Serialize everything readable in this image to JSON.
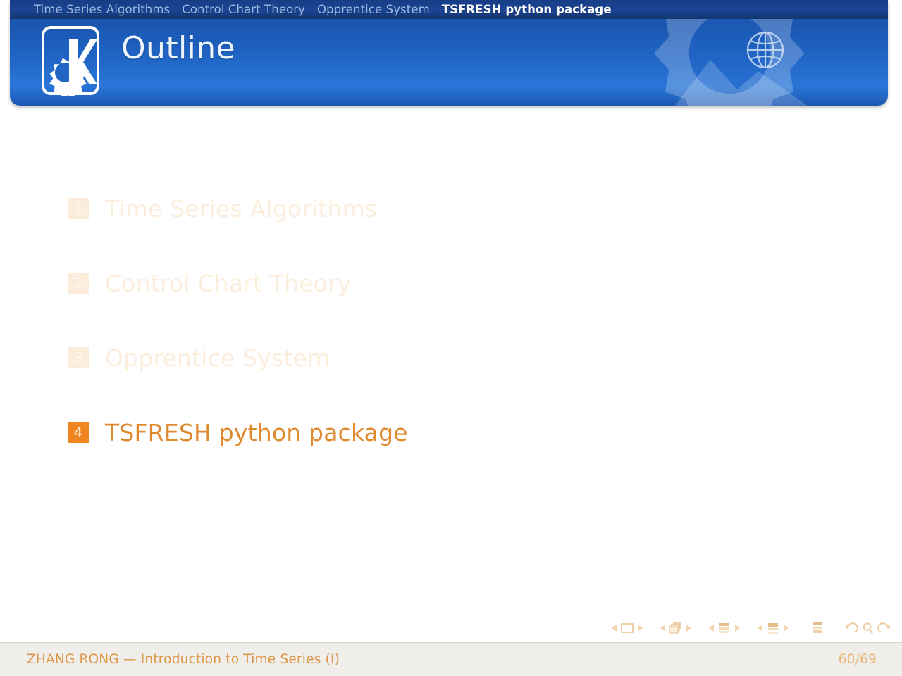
{
  "header": {
    "title": "Outline",
    "logo_icon": "kde-k-gear-logo",
    "globe_icon": "globe-icon",
    "gear_watermark_icon": "gear-watermark-icon",
    "mountain_watermark_icon": "mountain-watermark-icon",
    "navbar": [
      {
        "label": "Time Series Algorithms",
        "active": false
      },
      {
        "label": "Control Chart Theory",
        "active": false
      },
      {
        "label": "Opprentice System",
        "active": false
      },
      {
        "label": "TSFRESH python package",
        "active": true
      }
    ]
  },
  "outline": {
    "items": [
      {
        "number": "1",
        "label": "Time Series Algorithms",
        "state": "dim"
      },
      {
        "number": "2",
        "label": "Control Chart Theory",
        "state": "dim"
      },
      {
        "number": "3",
        "label": "Opprentice System",
        "state": "dim"
      },
      {
        "number": "4",
        "label": "TSFRESH python package",
        "state": "active"
      }
    ]
  },
  "nav_symbols": {
    "groups": [
      {
        "icon": "slide-navigation-icon",
        "prev": "◂",
        "next": "▸"
      },
      {
        "icon": "frame-navigation-icon",
        "prev": "◂",
        "next": "▸"
      },
      {
        "icon": "subsection-navigation-icon",
        "prev": "◂",
        "next": "▸"
      },
      {
        "icon": "section-navigation-icon",
        "prev": "◂",
        "next": "▸"
      }
    ],
    "presentation_icon": "presentation-document-icon",
    "back_icon": "back-arrow-icon",
    "search_icon": "search-magnifier-icon",
    "forward_icon": "forward-arrow-icon"
  },
  "footer": {
    "author_and_title": "ZHANG RONG — Introduction to Time Series (I)",
    "page": "60/69"
  },
  "colors": {
    "navbar_bg": "#1b4493",
    "title_band_bg": "#2064c4",
    "accent_orange": "#ef8521",
    "active_text": "#e08a30",
    "dim_text": "#fbeedd",
    "footer_bg": "#f0eeeb",
    "footer_text": "#dc9645",
    "footer_page": "#e8b97a"
  }
}
